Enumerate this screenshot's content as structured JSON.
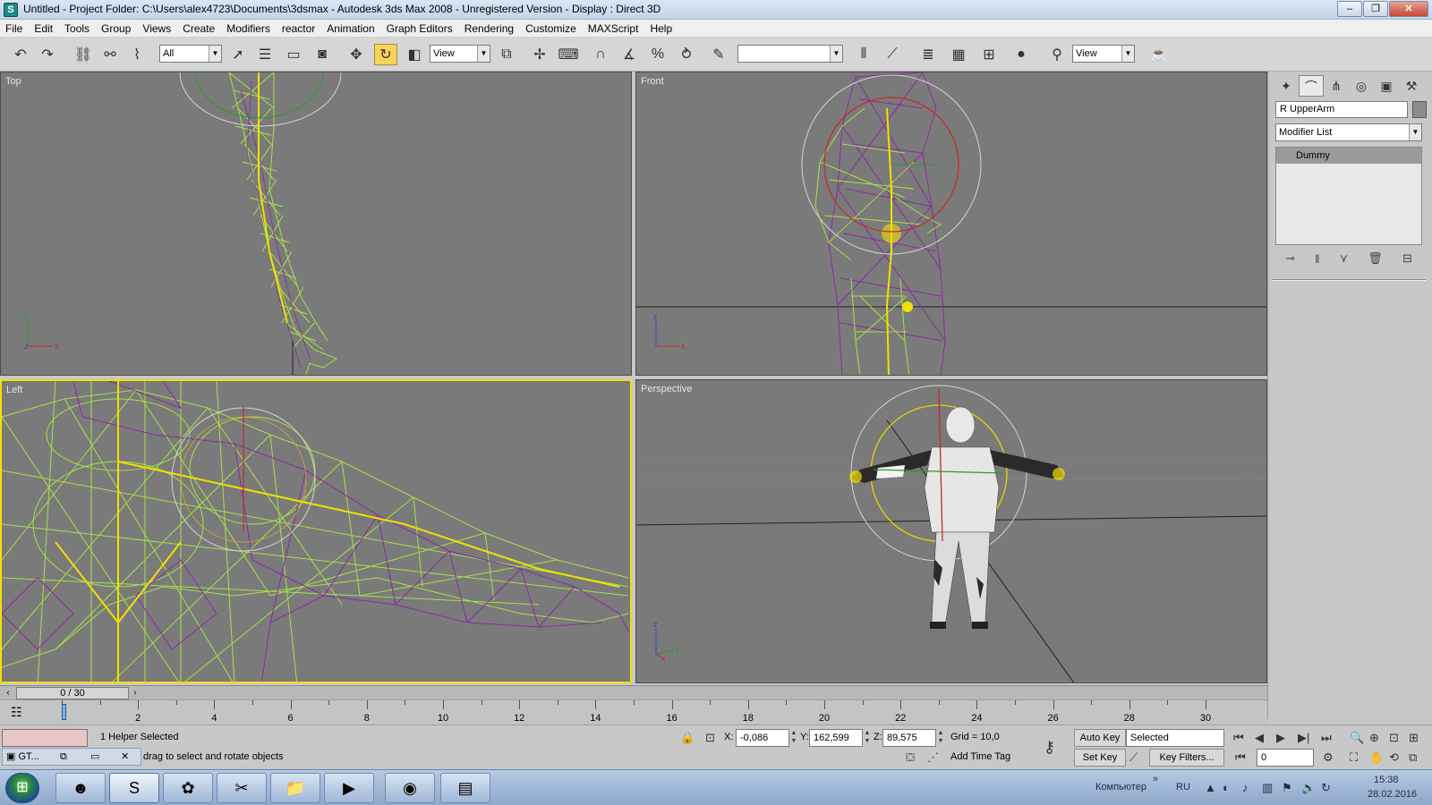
{
  "window": {
    "title": "Untitled     - Project Folder: C:\\Users\\alex4723\\Documents\\3dsmax     - Autodesk 3ds Max 2008     - Unregistered Version     - Display : Direct 3D",
    "minimize": "–",
    "maximize": "❐",
    "close": "✕"
  },
  "menu": [
    "File",
    "Edit",
    "Tools",
    "Group",
    "Views",
    "Create",
    "Modifiers",
    "reactor",
    "Animation",
    "Graph Editors",
    "Rendering",
    "Customize",
    "MAXScript",
    "Help"
  ],
  "toolbar": {
    "selection_filter": "All",
    "reference_coord": "View",
    "named_selection": "",
    "render_view": "View"
  },
  "viewports": {
    "top": "Top",
    "front": "Front",
    "left": "Left",
    "perspective": "Perspective",
    "axes_top": {
      "y": "y",
      "x": "x",
      "z": "z"
    },
    "axes_front": {
      "z": "z",
      "x": "x"
    },
    "axes_persp": {
      "z": "z",
      "x": "x",
      "y": "y"
    }
  },
  "command_panel": {
    "object_name": "R UpperArm",
    "modifier_list": "Modifier List",
    "stack": [
      "Dummy"
    ],
    "object_color": "#8c8c8c"
  },
  "timeline": {
    "slider_label": "0 / 30",
    "current_frame": 0,
    "total_frames": 30,
    "ticks": [
      "2",
      "4",
      "6",
      "8",
      "10",
      "12",
      "14",
      "16",
      "18",
      "20",
      "22",
      "24",
      "26",
      "28",
      "30"
    ]
  },
  "status": {
    "selection": "1 Helper Selected",
    "prompt": "drag to select and rotate objects",
    "x_label": "X:",
    "x_value": "-0,086",
    "y_label": "Y:",
    "y_value": "162,599",
    "z_label": "Z:",
    "z_value": "89,575",
    "grid": "Grid = 10,0",
    "add_time_tag": "Add Time Tag",
    "auto_key": "Auto Key",
    "set_key": "Set Key",
    "key_mode": "Selected",
    "key_filters": "Key Filters...",
    "frame_field": "0"
  },
  "gt_window": {
    "label": "GT..."
  },
  "taskbar": {
    "tray_lang_label": "Компьютер",
    "lang": "RU",
    "time": "15:38",
    "date": "28.02.2016"
  }
}
